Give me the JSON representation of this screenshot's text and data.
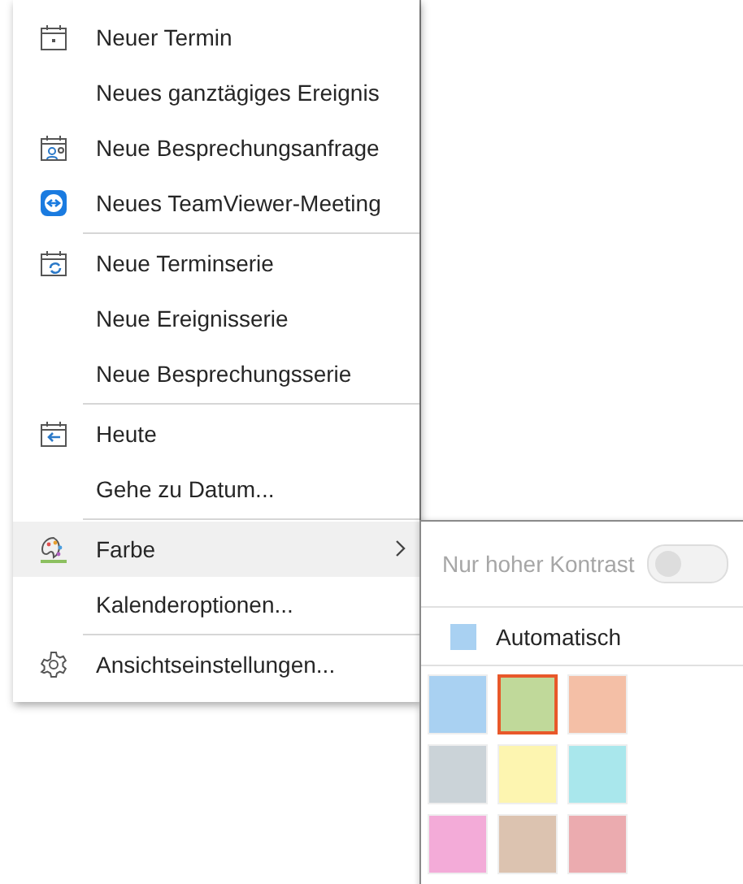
{
  "menu": {
    "groups": [
      [
        {
          "label": "Neuer Termin",
          "highlighted": false,
          "submenu": false
        },
        {
          "label": "Neues ganztägiges Ereignis",
          "highlighted": false,
          "submenu": false
        },
        {
          "label": "Neue Besprechungsanfrage",
          "highlighted": false,
          "submenu": false
        },
        {
          "label": "Neues TeamViewer-Meeting",
          "highlighted": false,
          "submenu": false
        }
      ],
      [
        {
          "label": "Neue Terminserie",
          "highlighted": false,
          "submenu": false
        },
        {
          "label": "Neue Ereignisserie",
          "highlighted": false,
          "submenu": false
        },
        {
          "label": "Neue Besprechungsserie",
          "highlighted": false,
          "submenu": false
        }
      ],
      [
        {
          "label": "Heute",
          "highlighted": false,
          "submenu": false
        },
        {
          "label": "Gehe zu Datum...",
          "highlighted": false,
          "submenu": false
        }
      ],
      [
        {
          "label": "Farbe",
          "highlighted": true,
          "submenu": true
        },
        {
          "label": "Kalenderoptionen...",
          "highlighted": false,
          "submenu": false
        }
      ],
      [
        {
          "label": "Ansichtseinstellungen...",
          "highlighted": false,
          "submenu": false
        }
      ]
    ]
  },
  "color_submenu": {
    "high_contrast": {
      "label": "Nur hoher Kontrast",
      "on": false,
      "disabled": true
    },
    "automatic": {
      "label": "Automatisch",
      "color": "#a9d1f2"
    },
    "swatches": [
      {
        "color": "#a9d1f2",
        "selected": false
      },
      {
        "color": "#c0d99a",
        "selected": true
      },
      {
        "color": "#f4bfa6",
        "selected": false
      },
      {
        "color": "#cbd3d8",
        "selected": false
      },
      {
        "color": "#fdf5b0",
        "selected": false
      },
      {
        "color": "#a9e7ec",
        "selected": false
      },
      {
        "color": "#f3abd8",
        "selected": false
      },
      {
        "color": "#dcc3b0",
        "selected": false
      },
      {
        "color": "#ebabaf",
        "selected": false
      }
    ]
  }
}
